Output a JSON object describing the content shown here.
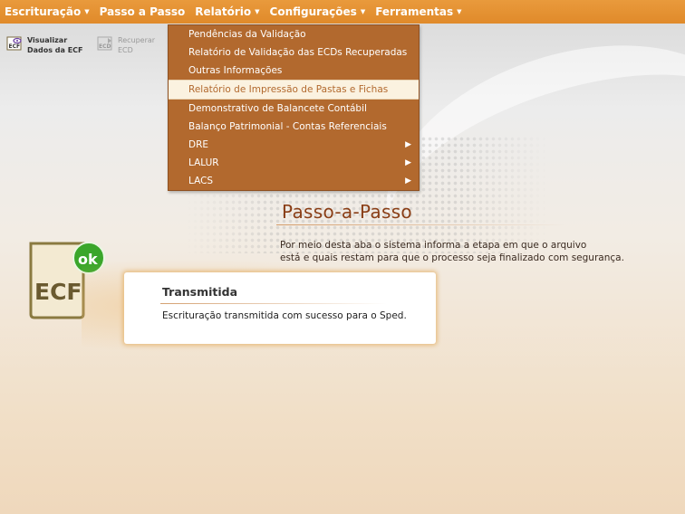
{
  "menubar": {
    "items": [
      {
        "label": "Escrituração",
        "has_caret": true
      },
      {
        "label": "Passo a Passo",
        "has_caret": false
      },
      {
        "label": "Relatório",
        "has_caret": true
      },
      {
        "label": "Configurações",
        "has_caret": true
      },
      {
        "label": "Ferramentas",
        "has_caret": true
      }
    ]
  },
  "toolbar": {
    "view_line1": "Visualizar",
    "view_line2": "Dados da ECF",
    "recover_line1": "Recuperar",
    "recover_line2": "ECD"
  },
  "relatorio_menu": {
    "items": [
      {
        "label": "Pendências da Validação"
      },
      {
        "label": "Relatório de Validação das ECDs Recuperadas"
      },
      {
        "label": "Outras Informações"
      },
      {
        "label": "Relatório de Impressão de Pastas e Fichas"
      },
      {
        "label": "Demonstrativo de Balancete Contábil"
      },
      {
        "label": "Balanço Patrimonial - Contas Referenciais"
      },
      {
        "label": "DRE"
      },
      {
        "label": "LALUR"
      },
      {
        "label": "LACS"
      }
    ]
  },
  "step": {
    "title": "Passo-a-Passo",
    "description_line1": "Por meio desta aba o sistema informa a etapa em que o arquivo",
    "description_line2": "está e quais restam para que o processo seja finalizado com segurança."
  },
  "badge": {
    "text": "ECF",
    "ok_text": "ok"
  },
  "status_card": {
    "title": "Transmitida",
    "message": "Escrituração transmitida com sucesso para o Sped."
  },
  "colors": {
    "menubar": "#e08a2a",
    "dropdown": "#b2692e",
    "highlight": "#fbf2e0",
    "title": "#8a3e16",
    "badge_green": "#3aa62a"
  }
}
